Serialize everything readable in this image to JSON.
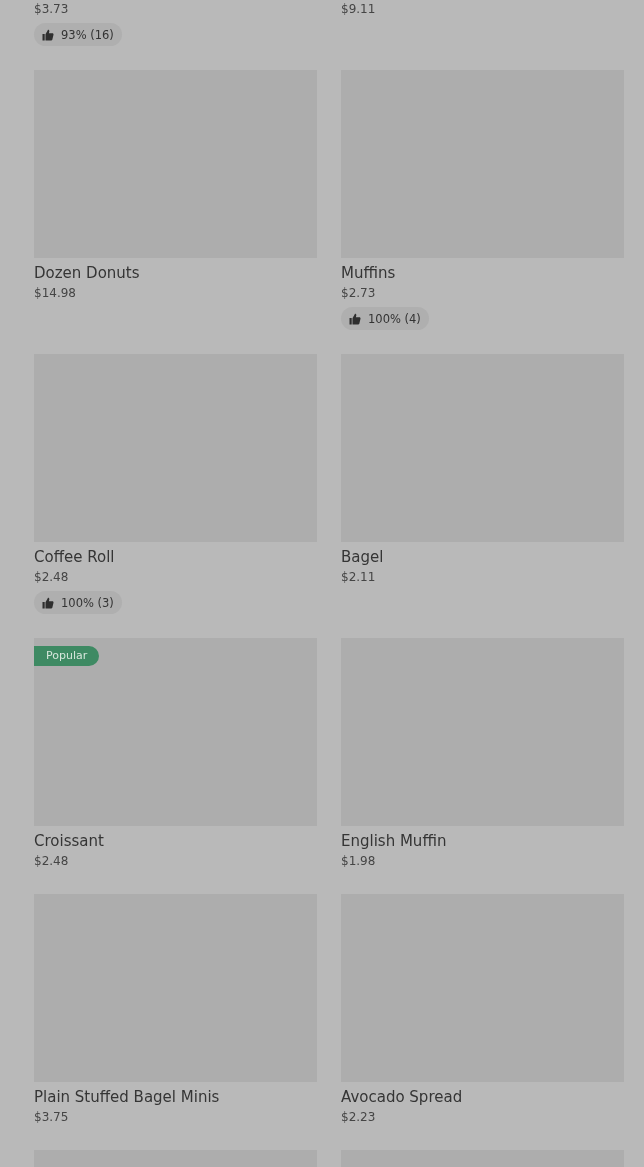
{
  "products": [
    {
      "image": false,
      "price": "$3.73",
      "rating": "93% (16)"
    },
    {
      "image": false,
      "price": "$9.11"
    },
    {
      "image": true,
      "name": "Dozen Donuts",
      "price": "$14.98"
    },
    {
      "image": true,
      "name": "Muffins",
      "price": "$2.73",
      "rating": "100% (4)"
    },
    {
      "image": true,
      "name": "Coffee Roll",
      "price": "$2.48",
      "rating": "100% (3)"
    },
    {
      "image": true,
      "name": "Bagel",
      "price": "$2.11"
    },
    {
      "image": true,
      "badge": "Popular",
      "name": "Croissant",
      "price": "$2.48"
    },
    {
      "image": true,
      "name": "English Muffin",
      "price": "$1.98"
    },
    {
      "image": true,
      "name": "Plain Stuffed Bagel Minis",
      "price": "$3.75"
    },
    {
      "image": true,
      "name": "Avocado Spread",
      "price": "$2.23"
    },
    {
      "image": true
    },
    {
      "image": true
    }
  ]
}
